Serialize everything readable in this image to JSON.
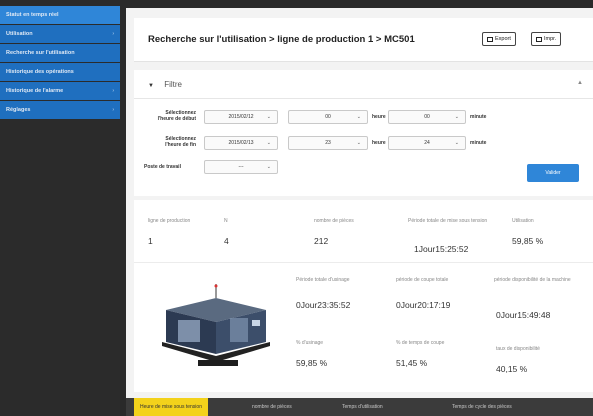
{
  "sidebar": {
    "items": [
      {
        "label": "Statut en temps réel"
      },
      {
        "label": "Utilisation"
      },
      {
        "label": "Recherche sur l'utilisation"
      },
      {
        "label": "Historique des opérations"
      },
      {
        "label": "Historique de l'alarme"
      },
      {
        "label": "Réglages"
      }
    ]
  },
  "header": {
    "title": "Recherche sur l'utilisation > ligne de production 1 > MC501",
    "export_label": "Export",
    "print_label": "Impr."
  },
  "filter": {
    "title": "Filtre",
    "start_label_1": "Sélectionnez",
    "start_label_2": "l'heure de début",
    "end_label_1": "Sélectionnez",
    "end_label_2": "l'heure de fin",
    "workstation_label": "Poste de travail",
    "start_date": "2015/02/12",
    "start_hour": "00",
    "start_minute": "00",
    "end_date": "2015/02/13",
    "end_hour": "23",
    "end_minute": "24",
    "workstation_value": "---",
    "hour_unit": "heure",
    "minute_unit": "minute",
    "submit_label": "Valider"
  },
  "stats": {
    "headers": {
      "production_line": "ligne de production",
      "n": "N",
      "pieces": "nombre de pièces",
      "power_on_period": "Période totale de mise sous tension",
      "utilisation": "Utilisation"
    },
    "values": {
      "production_line": "1",
      "n": "4",
      "pieces": "212",
      "power_on_period": "1Jour15:25:52",
      "utilisation": "59,85 %"
    },
    "detail": {
      "machining_period_label": "Période totale d'usinage",
      "machining_period": "0Jour23:35:52",
      "cutting_period_label": "période de coupe totale",
      "cutting_period": "0Jour20:17:19",
      "availability_period_label": "période disponibilité de la machine",
      "availability_period": "0Jour15:49:48",
      "machining_rate_label": "% d'usinage",
      "machining_rate": "59,85 %",
      "cutting_rate_label": "% de temps de coupe",
      "cutting_rate": "51,45 %",
      "availability_rate_label": "taux de disponibilité",
      "availability_rate": "40,15 %"
    }
  },
  "tabs": [
    {
      "label": "Heure de mise sous tension"
    },
    {
      "label": "nombre de pièces"
    },
    {
      "label": "Temps d'utilisation"
    },
    {
      "label": "Temps de cycle des pièces"
    }
  ],
  "colors": {
    "accent": "#2f86d8",
    "sidebar_item": "#1f6fbf",
    "active_tab": "#f3d21b"
  }
}
